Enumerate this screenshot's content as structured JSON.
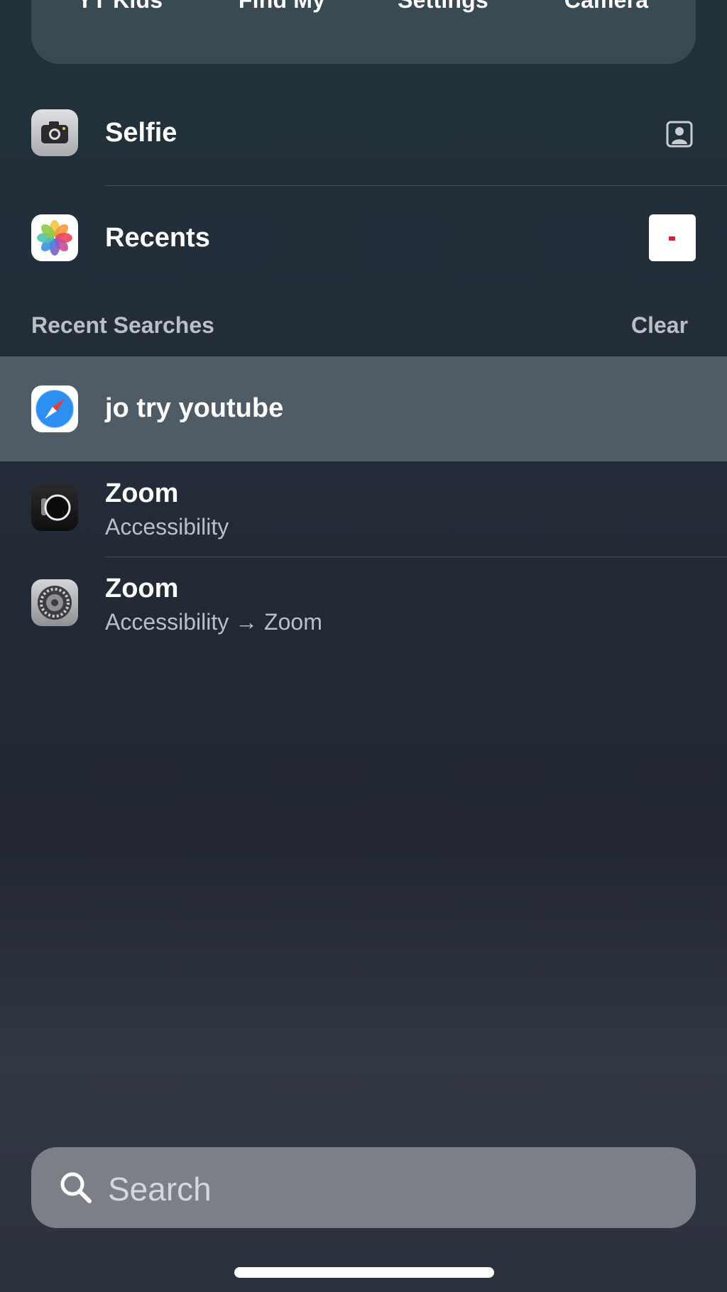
{
  "suggestions": {
    "apps": [
      {
        "label": "YT Kids",
        "icon": "yt-kids-icon",
        "tile_color": "#f1f1f1"
      },
      {
        "label": "Find My",
        "icon": "find-my-icon",
        "tile_color": "#d7dde0"
      },
      {
        "label": "Settings",
        "icon": "settings-icon",
        "tile_color": "#8c9397"
      },
      {
        "label": "Camera",
        "icon": "camera-icon",
        "tile_color": "#8c9397"
      }
    ]
  },
  "shortcuts": [
    {
      "title": "Selfie",
      "icon": "camera-icon",
      "accessory": "portrait-contact-icon"
    },
    {
      "title": "Recents",
      "icon": "photos-icon",
      "accessory": "photo-thumbnail"
    }
  ],
  "recent_searches": {
    "header": "Recent Searches",
    "clear_label": "Clear",
    "items": [
      {
        "title": "jo try youtube",
        "icon": "safari-icon",
        "highlighted": true
      },
      {
        "title": "Zoom",
        "subtitle": "Accessibility",
        "icon": "watch-icon"
      },
      {
        "title": "Zoom",
        "subtitle": "Accessibility → Zoom",
        "icon": "settings-icon"
      }
    ]
  },
  "search": {
    "placeholder": "Search",
    "icon": "search-icon"
  }
}
